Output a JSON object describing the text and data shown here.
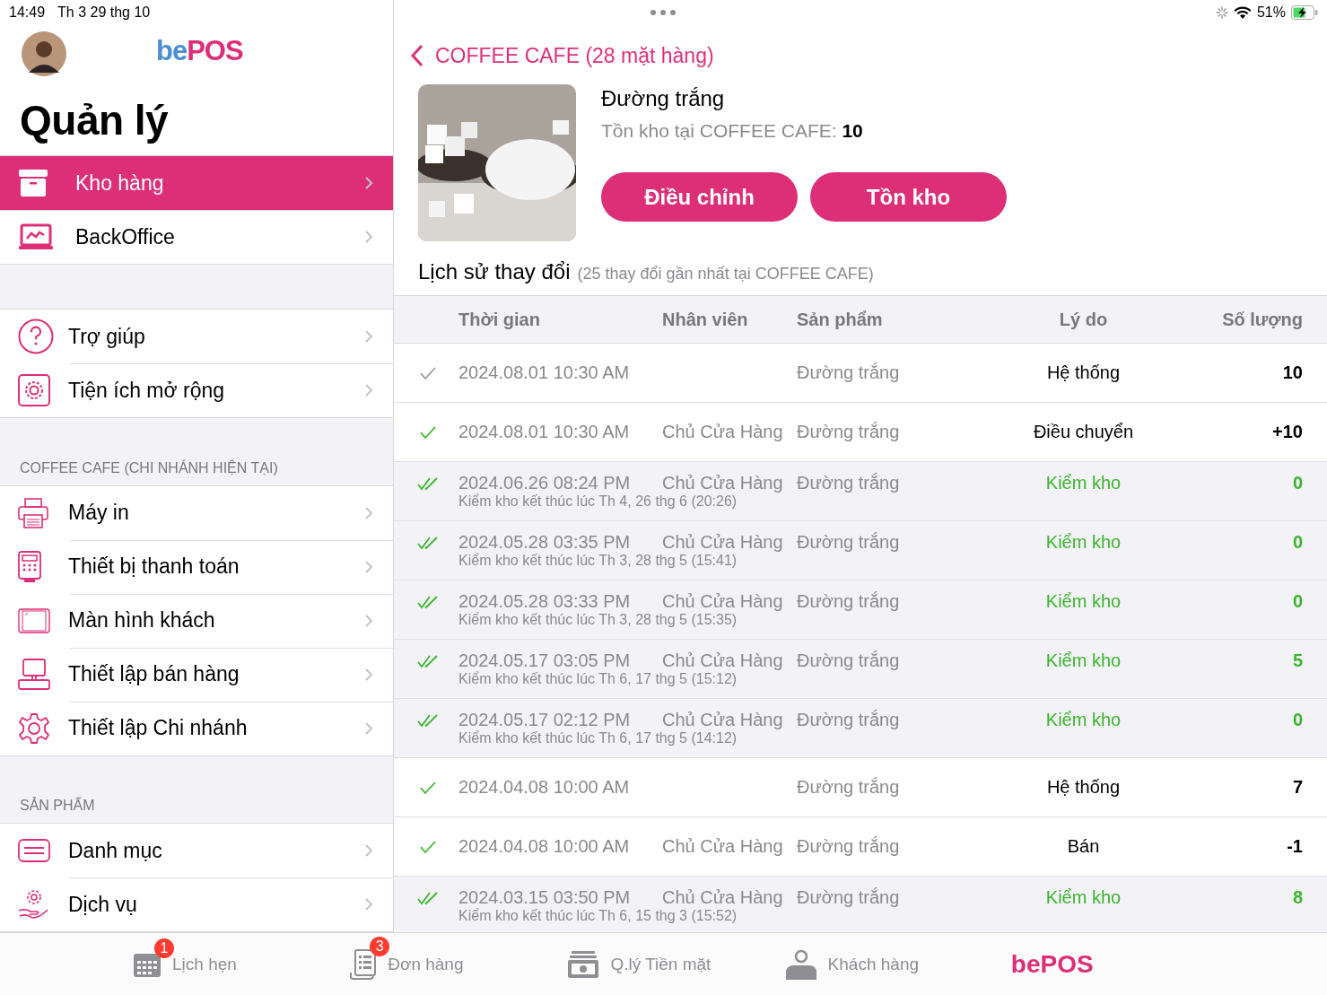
{
  "status_bar": {
    "time": "14:49",
    "date": "Th 3 29 thg 10",
    "battery": "51%"
  },
  "sidebar": {
    "logo": {
      "prefix": "be",
      "suffix": "POS"
    },
    "title": "Quản lý",
    "groups": [
      {
        "items": [
          {
            "label": "Kho hàng",
            "selected": true
          },
          {
            "label": "BackOffice",
            "selected": false
          }
        ]
      },
      {
        "items": [
          {
            "label": "Trợ giúp",
            "selected": false
          },
          {
            "label": "Tiện ích mở rộng",
            "selected": false
          }
        ]
      },
      {
        "header": "COFFEE CAFE (CHI NHÁNH HIỆN TẠI)",
        "items": [
          {
            "label": "Máy in",
            "selected": false
          },
          {
            "label": "Thiết bị thanh toán",
            "selected": false
          },
          {
            "label": "Màn hình khách",
            "selected": false
          },
          {
            "label": "Thiết lập bán hàng",
            "selected": false
          },
          {
            "label": "Thiết lập Chi nhánh",
            "selected": false
          }
        ]
      },
      {
        "header": "SẢN PHẨM",
        "items": [
          {
            "label": "Danh mục",
            "selected": false
          },
          {
            "label": "Dịch vụ",
            "selected": false
          }
        ]
      }
    ]
  },
  "detail": {
    "back": "COFFEE CAFE (28 mặt hàng)",
    "product": {
      "kind": "picture",
      "name": "Đường trắng",
      "stock_label": "Tồn kho tại COFFEE CAFE:",
      "stock_value": "10"
    },
    "buttons": [
      "Điều chỉnh",
      "Tồn kho"
    ],
    "history": {
      "title": "Lịch sử thay đổi",
      "subtitle": "(25 thay đổi gần nhất tại COFFEE CAFE)",
      "columns": [
        "Thời gian",
        "Nhân viên",
        "Sản phẩm",
        "Lý do",
        "Số lượng"
      ],
      "rows": [
        {
          "kind": "change",
          "confirmed": false,
          "time": "2024.08.01 10:30 AM",
          "staff": "",
          "product": "Đường trắng",
          "reason": "Hệ thống",
          "quantity": "10"
        },
        {
          "kind": "change",
          "confirmed": true,
          "time": "2024.08.01 10:30 AM",
          "staff": "Chủ Cửa Hàng",
          "product": "Đường trắng",
          "reason": "Điều chuyển",
          "quantity": "+10"
        },
        {
          "kind": "stock_check",
          "confirmed": true,
          "time": "2024.06.26 08:24 PM",
          "staff": "Chủ Cửa Hàng",
          "product": "Đường trắng",
          "reason": "Kiểm kho",
          "quantity": "0",
          "note": "Kiểm kho kết thúc lúc Th 4, 26 thg 6 (20:26)"
        },
        {
          "kind": "stock_check",
          "confirmed": true,
          "time": "2024.05.28 03:35 PM",
          "staff": "Chủ Cửa Hàng",
          "product": "Đường trắng",
          "reason": "Kiểm kho",
          "quantity": "0",
          "note": "Kiểm kho kết thúc lúc Th 3, 28 thg 5 (15:41)"
        },
        {
          "kind": "stock_check",
          "confirmed": true,
          "time": "2024.05.28 03:33 PM",
          "staff": "Chủ Cửa Hàng",
          "product": "Đường trắng",
          "reason": "Kiểm kho",
          "quantity": "0",
          "note": "Kiểm kho kết thúc lúc Th 3, 28 thg 5 (15:35)"
        },
        {
          "kind": "stock_check",
          "confirmed": true,
          "time": "2024.05.17 03:05 PM",
          "staff": "Chủ Cửa Hàng",
          "product": "Đường trắng",
          "reason": "Kiểm kho",
          "quantity": "5",
          "note": "Kiểm kho kết thúc lúc Th 6, 17 thg 5 (15:12)"
        },
        {
          "kind": "stock_check",
          "confirmed": true,
          "time": "2024.05.17 02:12 PM",
          "staff": "Chủ Cửa Hàng",
          "product": "Đường trắng",
          "reason": "Kiểm kho",
          "quantity": "0",
          "note": "Kiểm kho kết thúc lúc Th 6, 17 thg 5 (14:12)"
        },
        {
          "kind": "change",
          "confirmed": true,
          "time": "2024.04.08 10:00 AM",
          "staff": "",
          "product": "Đường trắng",
          "reason": "Hệ thống",
          "quantity": "7"
        },
        {
          "kind": "change",
          "confirmed": true,
          "time": "2024.04.08 10:00 AM",
          "staff": "Chủ Cửa Hàng",
          "product": "Đường trắng",
          "reason": "Bán",
          "quantity": "-1"
        },
        {
          "kind": "stock_check",
          "confirmed": true,
          "time": "2024.03.15 03:50 PM",
          "staff": "Chủ Cửa Hàng",
          "product": "Đường trắng",
          "reason": "Kiểm kho",
          "quantity": "8",
          "note": "Kiểm kho kết thúc lúc Th 6, 15 thg 3 (15:52)"
        }
      ]
    }
  },
  "tab_bar": [
    {
      "kind": "calendar",
      "label": "Lịch hẹn",
      "badge": "1"
    },
    {
      "kind": "orders",
      "label": "Đơn hàng",
      "badge": "3"
    },
    {
      "kind": "cash",
      "label": "Q.lý Tiền mặt"
    },
    {
      "kind": "customer",
      "label": "Khách hàng"
    },
    {
      "kind": "logo",
      "label": "bePOS"
    }
  ]
}
